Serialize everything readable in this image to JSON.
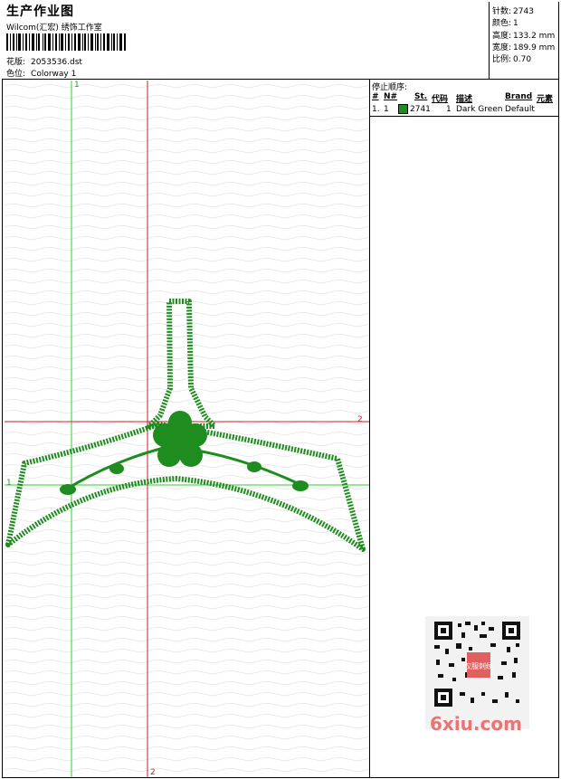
{
  "header": {
    "title": "生产作业图",
    "company": "Wilcom(汇宏) 绣饰工作室",
    "design_label": "花版:",
    "design_file": "2053536.dst",
    "colorway_label": "色位:",
    "colorway": "Colorway 1"
  },
  "stats": [
    {
      "label": "针数:",
      "value": "2743"
    },
    {
      "label": "颜色:",
      "value": "1"
    },
    {
      "label": "高度:",
      "value": "133.2 mm"
    },
    {
      "label": "宽度:",
      "value": "189.9 mm"
    },
    {
      "label": "比例:",
      "value": "0.70"
    }
  ],
  "stop_sequence": {
    "title": "停止顺序:",
    "headers": [
      "#",
      "N#",
      "St.",
      "代码",
      "描述",
      "Brand",
      "元素"
    ],
    "rows": [
      {
        "index": "1.",
        "n": "1",
        "color": "#1e8c1e",
        "stitches": "2741",
        "code": "1",
        "description": "Dark Green",
        "brand": "Default",
        "element": ""
      }
    ]
  },
  "guides": {
    "green_label_top": "1",
    "green_label_left": "1",
    "red_label_right": "2",
    "red_label_bottom": "2"
  },
  "colors": {
    "thread": "#1e8c1e",
    "guide_green": "#33cc33",
    "guide_red": "#cc2222",
    "watermark": "#e87575"
  },
  "watermark": {
    "text": "6xiu.com",
    "seal_text": "汉服刺绣"
  }
}
